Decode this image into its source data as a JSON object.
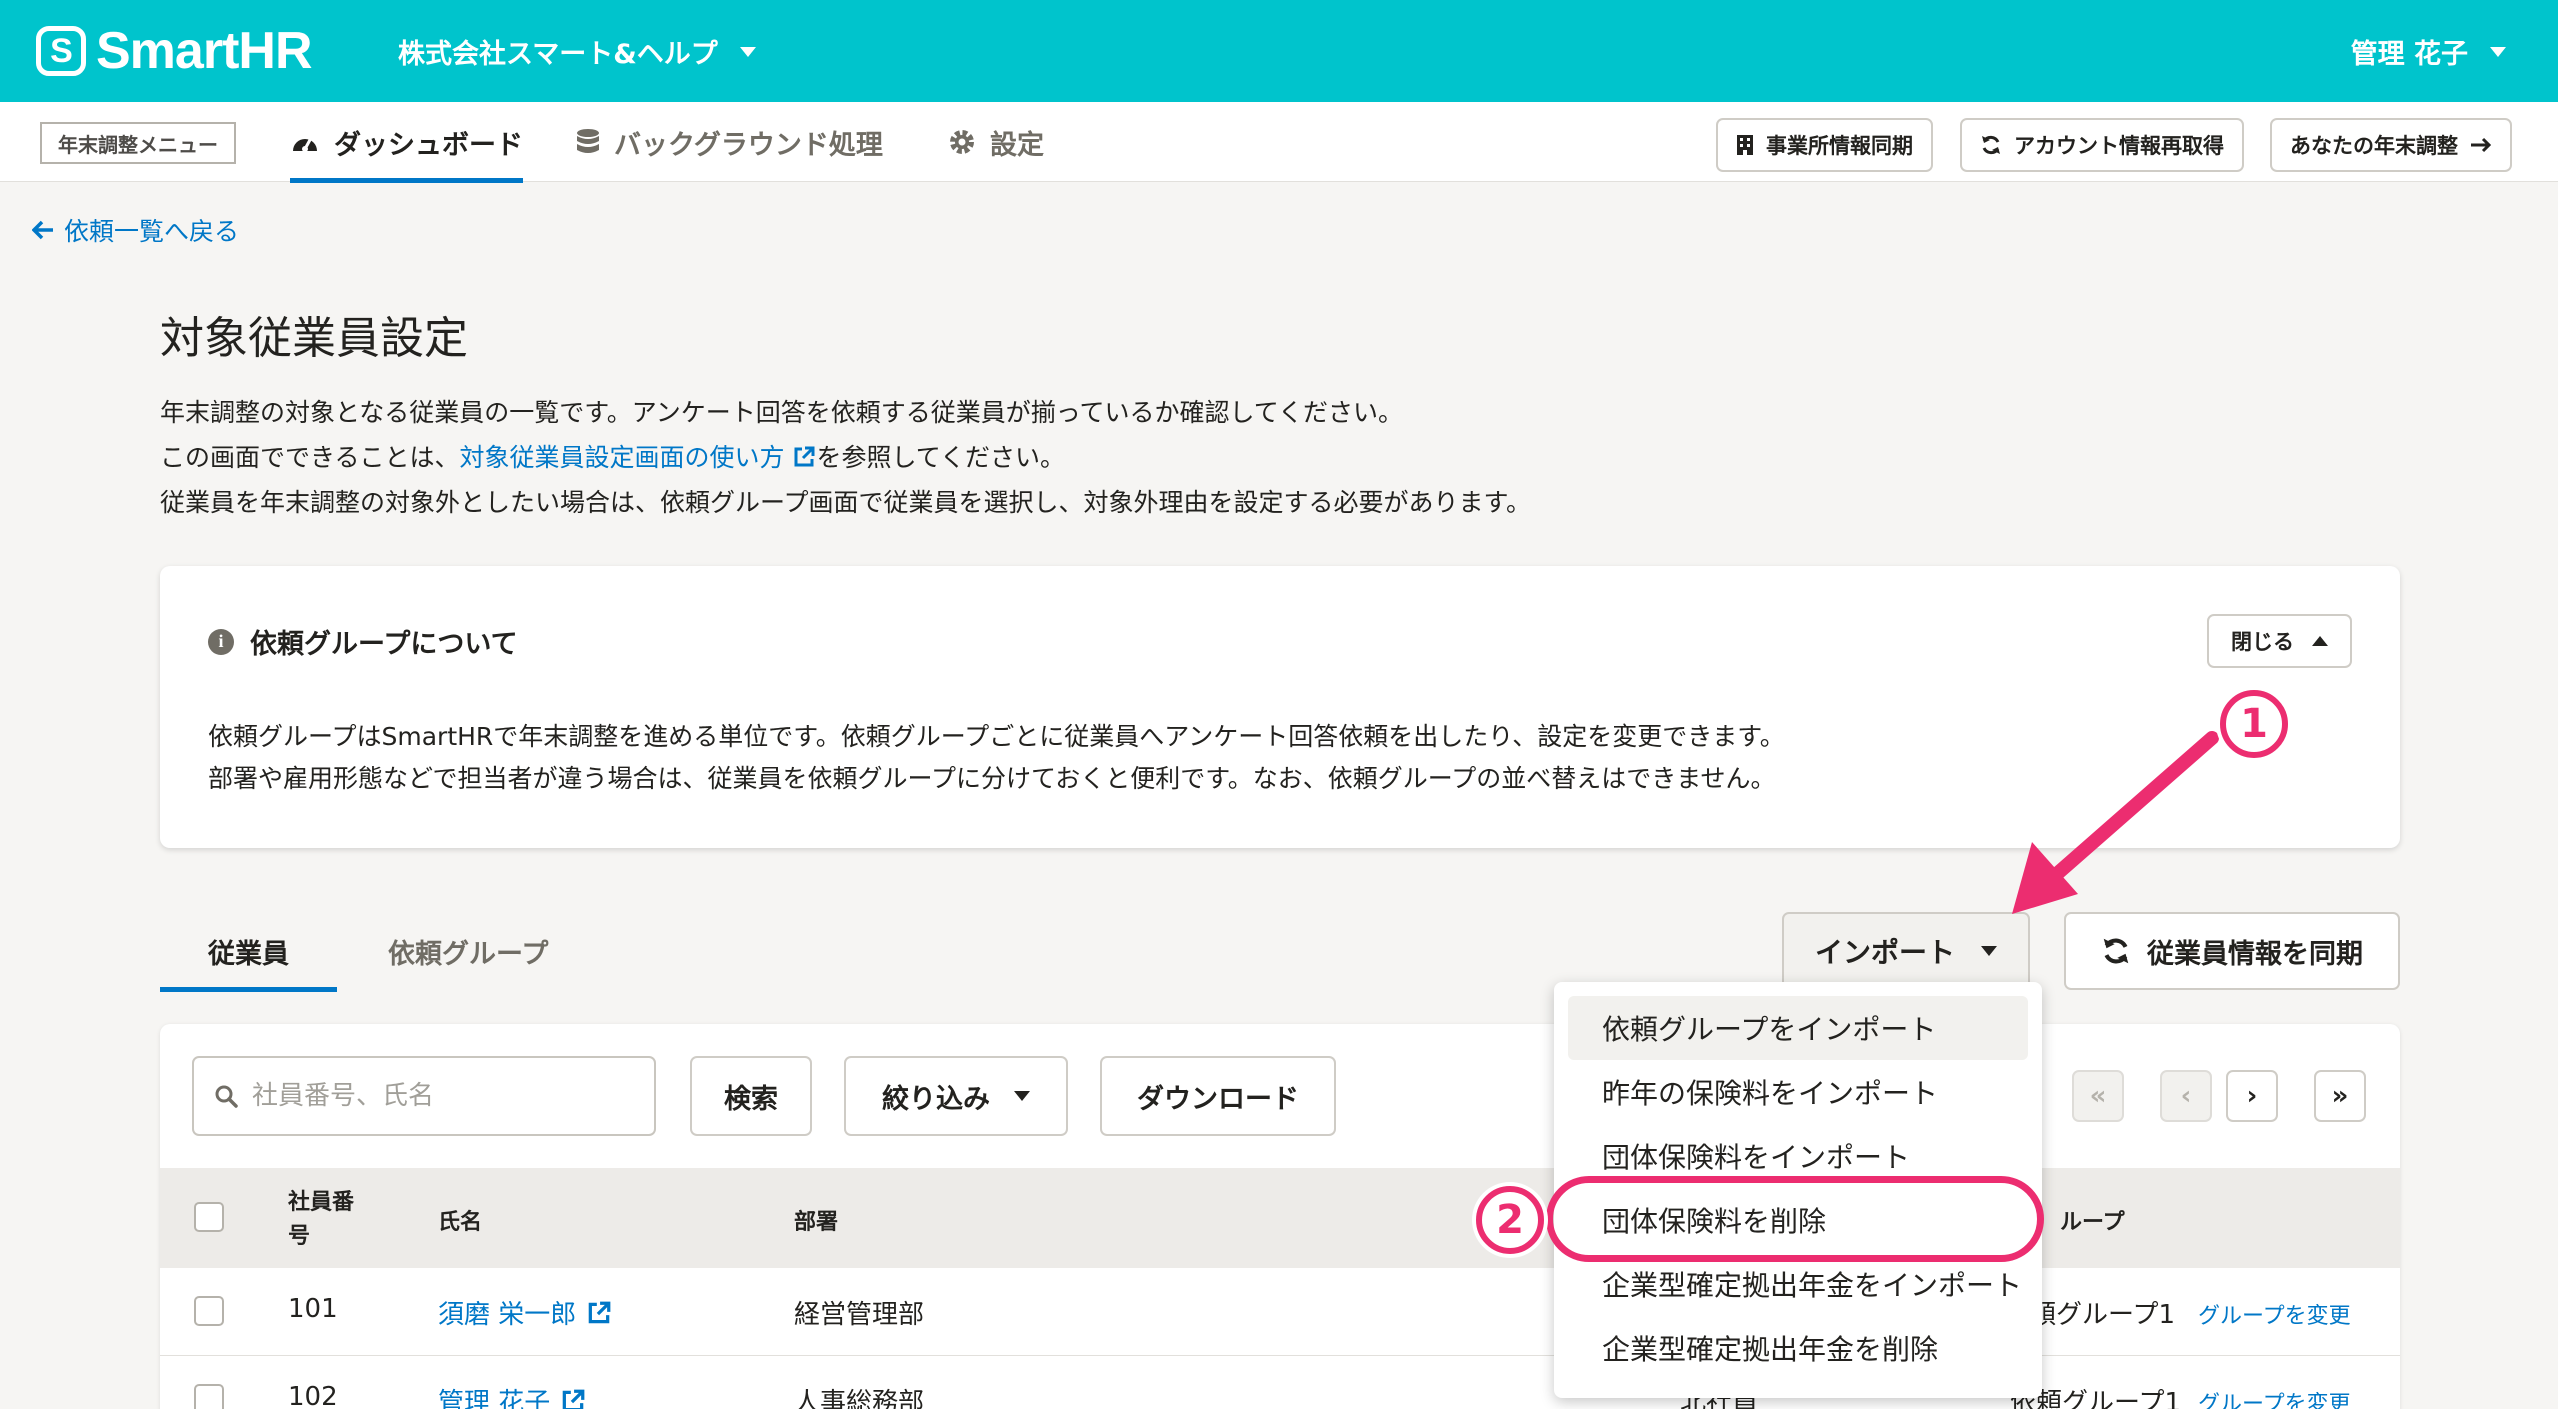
{
  "header": {
    "logo_text": "SmartHR",
    "company": "株式会社スマート&ヘルプ",
    "user": "管理 花子",
    "brand_color": "#00c4cc"
  },
  "subnav": {
    "menu_tag": "年末調整メニュー",
    "tabs": [
      {
        "label": "ダッシュボード",
        "icon": "dashboard-icon"
      },
      {
        "label": "バックグラウンド処理",
        "icon": "database-icon"
      },
      {
        "label": "設定",
        "icon": "gear-icon"
      }
    ],
    "buttons": [
      {
        "label": "事業所情報同期",
        "icon": "building-icon"
      },
      {
        "label": "アカウント情報再取得",
        "icon": "refresh-icon"
      },
      {
        "label": "あなたの年末調整",
        "icon": "arrow-right-icon"
      }
    ]
  },
  "back_link": "依頼一覧へ戻る",
  "page": {
    "title": "対象従業員設定",
    "desc_line1": "年末調整の対象となる従業員の一覧です。アンケート回答を依頼する従業員が揃っているか確認してください。",
    "desc_line2_pre": "この画面でできることは、",
    "desc_line2_link": "対象従業員設定画面の使い方",
    "desc_line2_post": "を参照してください。",
    "desc_line3": "従業員を年末調整の対象外としたい場合は、依頼グループ画面で従業員を選択し、対象外理由を設定する必要があります。"
  },
  "panel": {
    "title": "依頼グループについて",
    "close_label": "閉じる",
    "body_line1": "依頼グループはSmartHRで年末調整を進める単位です。依頼グループごとに従業員へアンケート回答依頼を出したり、設定を変更できます。",
    "body_line2": "部署や雇用形態などで担当者が違う場合は、従業員を依頼グループに分けておくと便利です。なお、依頼グループの並べ替えはできません。"
  },
  "tabs": [
    {
      "label": "従業員",
      "active": true
    },
    {
      "label": "依頼グループ",
      "active": false
    }
  ],
  "import_button": "インポート",
  "sync_button": "従業員情報を同期",
  "search": {
    "placeholder": "社員番号、氏名",
    "search_label": "検索",
    "filter_label": "絞り込み",
    "download_label": "ダウンロード"
  },
  "pager": {
    "first": "«",
    "prev": "‹",
    "next": "›",
    "last": "»"
  },
  "table": {
    "headers": {
      "emp_no_1": "社員番",
      "emp_no_2": "号",
      "name": "氏名",
      "dept": "部署",
      "group": "ループ"
    },
    "rows": [
      {
        "no": "101",
        "name": "須磨 栄一郎",
        "dept": "経営管理部",
        "group": "頼グループ1",
        "change": "グループを変更"
      },
      {
        "no": "102",
        "name": "管理 花子",
        "dept": "人事総務部",
        "group": "依頼グループ1",
        "change": "グループを変更",
        "extra": "北社員"
      }
    ]
  },
  "dropdown": {
    "items": [
      "依頼グループをインポート",
      "昨年の保険料をインポート",
      "団体保険料をインポート",
      "団体保険料を削除",
      "企業型確定拠出年金をインポート",
      "企業型確定拠出年金を削除"
    ]
  },
  "annotations": {
    "step1": "1",
    "step2": "2",
    "color": "#ec2d70"
  }
}
